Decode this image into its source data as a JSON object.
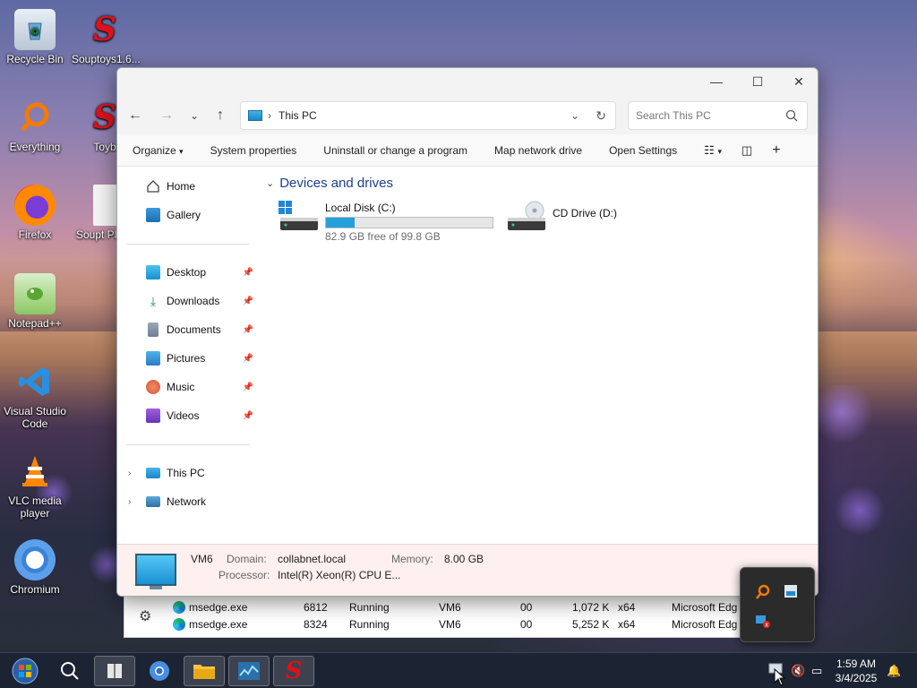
{
  "desktop": {
    "icons": [
      {
        "label": "Recycle Bin"
      },
      {
        "label": "Souptoys1.6..."
      },
      {
        "label": "Everything"
      },
      {
        "label": "Toyb"
      },
      {
        "label": "Firefox"
      },
      {
        "label": "Soupt Plays"
      },
      {
        "label": "Notepad++"
      },
      {
        "label": "Visual Studio Code"
      },
      {
        "label": "VLC media player"
      },
      {
        "label": "Chromium"
      }
    ]
  },
  "explorer": {
    "address": "This PC",
    "search_placeholder": "Search This PC",
    "controls": {
      "minimize": "—",
      "maximize": "☐",
      "close": "✕"
    },
    "toolbar": {
      "organize": "Organize",
      "system_properties": "System properties",
      "uninstall": "Uninstall or change a program",
      "map_drive": "Map network drive",
      "open_settings": "Open Settings"
    },
    "sidebar": {
      "home": "Home",
      "gallery": "Gallery",
      "desktop": "Desktop",
      "downloads": "Downloads",
      "documents": "Documents",
      "pictures": "Pictures",
      "music": "Music",
      "videos": "Videos",
      "this_pc": "This PC",
      "network": "Network"
    },
    "group_title": "Devices and drives",
    "drives": [
      {
        "name": "Local Disk (C:)",
        "free_text": "82.9 GB free of 99.8 GB",
        "used_fraction": 0.17
      },
      {
        "name": "CD Drive (D:)"
      }
    ],
    "details": {
      "computer_name": "VM6",
      "domain_label": "Domain:",
      "domain_value": "collabnet.local",
      "memory_label": "Memory:",
      "memory_value": "8.00 GB",
      "processor_label": "Processor:",
      "processor_value": "Intel(R) Xeon(R) CPU E..."
    }
  },
  "task_manager": {
    "rows": [
      {
        "name": "msedge.exe",
        "pid": "6812",
        "status": "Running",
        "user": "VM6",
        "cpu": "00",
        "memory": "1,072 K",
        "arch": "x64",
        "description": "Microsoft Edg"
      },
      {
        "name": "msedge.exe",
        "pid": "8324",
        "status": "Running",
        "user": "VM6",
        "cpu": "00",
        "memory": "5,252 K",
        "arch": "x64",
        "description": "Microsoft Edg"
      }
    ]
  },
  "taskbar": {
    "time": "1:59 AM",
    "date": "3/4/2025"
  },
  "colors": {
    "accent": "#26a0da",
    "taskbar": "#1c2433",
    "details_bg": "#fdf0ee",
    "group_title": "#1a3f8a"
  }
}
